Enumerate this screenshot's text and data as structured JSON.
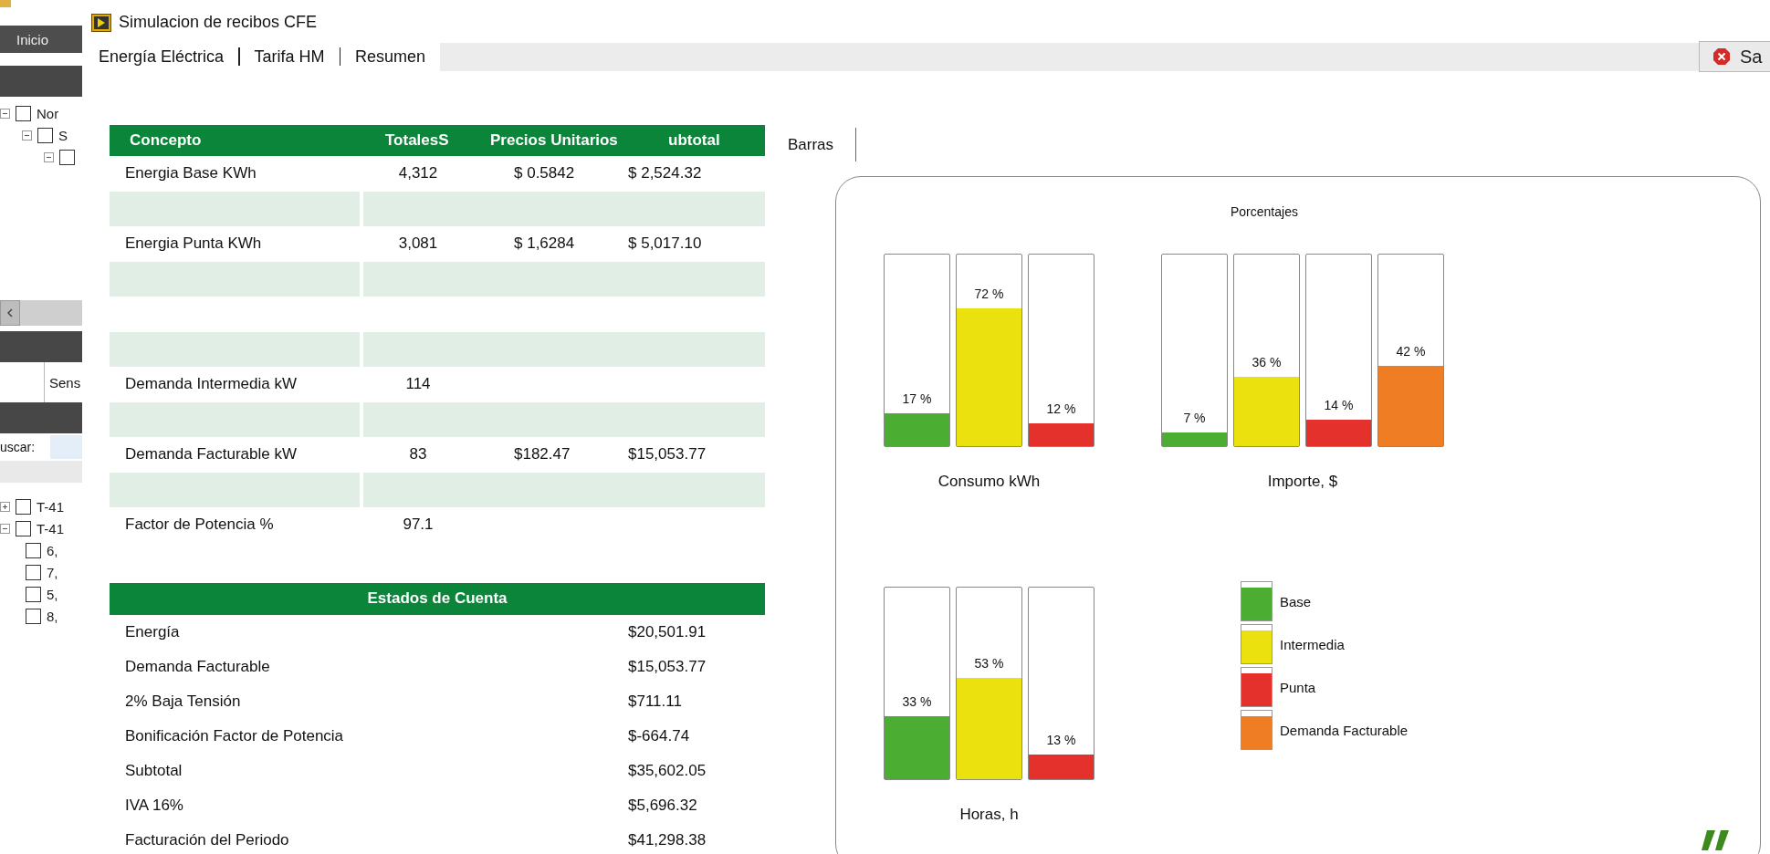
{
  "side_panel": {
    "start_button": "Inicio",
    "tree": [
      {
        "label": "Nor",
        "checked": false,
        "expanded": true,
        "children": [
          {
            "label": "S",
            "checked": false,
            "expanded": true,
            "children": [
              {
                "checked": false,
                "expanded": true
              }
            ]
          }
        ]
      }
    ],
    "column_header": "Sens",
    "search_label": "uscar:",
    "list": [
      {
        "label": "T-41",
        "checked": false,
        "expanded": false
      },
      {
        "label": "T-41",
        "checked": false,
        "expanded": true,
        "children": [
          {
            "label": "6,",
            "checked": false
          },
          {
            "label": "7,",
            "checked": false
          },
          {
            "label": "5,",
            "checked": false
          },
          {
            "label": "8,",
            "checked": false
          }
        ]
      }
    ]
  },
  "window": {
    "title": "Simulacion de recibos CFE"
  },
  "tabs": [
    {
      "label": "Energía Eléctrica"
    },
    {
      "label": "Tarifa HM"
    },
    {
      "label": "Resumen"
    }
  ],
  "close_button": "Sa",
  "table": {
    "columns": [
      "Concepto",
      "TotalesS",
      "Precios Unitarios",
      "ubtotal"
    ],
    "rows": [
      {
        "kind": "data",
        "cells": [
          "Energia Base KWh",
          "4,312",
          "$ 0.5842",
          "$ 2,524.32"
        ]
      },
      {
        "kind": "band"
      },
      {
        "kind": "data",
        "cells": [
          "Energia Punta KWh",
          "3,081",
          "$ 1,6284",
          "$ 5,017.10"
        ]
      },
      {
        "kind": "band"
      },
      {
        "kind": "blank"
      },
      {
        "kind": "band"
      },
      {
        "kind": "data",
        "cells": [
          "Demanda Intermedia kW",
          "114"
        ]
      },
      {
        "kind": "band"
      },
      {
        "kind": "data",
        "cells": [
          "Demanda Facturable kW",
          "83",
          "$182.47",
          "$15,053.77"
        ]
      },
      {
        "kind": "band"
      },
      {
        "kind": "data",
        "cells": [
          "Factor de Potencia %",
          "97.1"
        ]
      }
    ]
  },
  "account": {
    "title": "Estados de Cuenta",
    "rows": [
      {
        "label": "Energía",
        "value": "$20,501.91"
      },
      {
        "label": "Demanda Facturable",
        "value": "$15,053.77"
      },
      {
        "label": "2% Baja Tensión",
        "value": "$711.11"
      },
      {
        "label": "Bonificación Factor de Potencia",
        "value": "$-664.74"
      },
      {
        "label": "Subtotal",
        "value": "$35,602.05"
      },
      {
        "label": "IVA 16%",
        "value": "$5,696.32"
      },
      {
        "label": "Facturación del Periodo",
        "value": "$41,298.38"
      }
    ]
  },
  "chart_panel": {
    "tab": "Barras",
    "title": "Porcentajes",
    "groups": [
      {
        "name": "Consumo kWh",
        "bars": [
          {
            "label": "17 %",
            "level": 0.17,
            "color": "#4cad33"
          },
          {
            "label": "72 %",
            "level": 0.72,
            "color": "#ebe10f"
          },
          {
            "label": "12 %",
            "level": 0.12,
            "color": "#e5312b"
          }
        ]
      },
      {
        "name": "Importe, $",
        "bars": [
          {
            "label": "7 %",
            "level": 0.07,
            "color": "#4cad33"
          },
          {
            "label": "36 %",
            "level": 0.36,
            "color": "#ebe10f"
          },
          {
            "label": "14 %",
            "level": 0.14,
            "color": "#e5312b"
          },
          {
            "label": "42 %",
            "level": 0.42,
            "color": "#ee7d23"
          }
        ]
      },
      {
        "name": "Horas, h",
        "bars": [
          {
            "label": "33 %",
            "level": 0.33,
            "color": "#4cad33"
          },
          {
            "label": "53 %",
            "level": 0.53,
            "color": "#ebe10f"
          },
          {
            "label": "13 %",
            "level": 0.13,
            "color": "#e5312b"
          }
        ]
      }
    ],
    "legend": [
      {
        "label": "Base",
        "color": "#4cad33"
      },
      {
        "label": "Intermedia",
        "color": "#ebe10f"
      },
      {
        "label": "Punta",
        "color": "#e5312b"
      },
      {
        "label": "Demanda Facturable",
        "color": "#ee7d23"
      }
    ]
  }
}
